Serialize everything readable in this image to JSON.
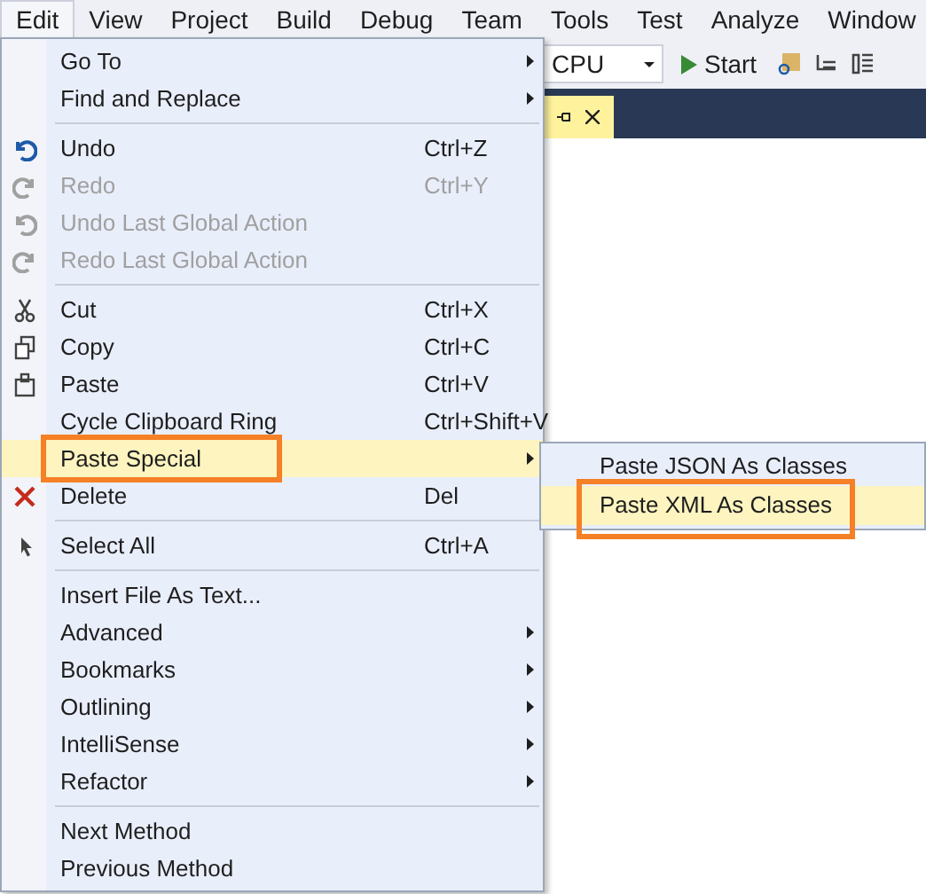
{
  "menu_bar": [
    {
      "label": "Edit",
      "selected": true
    },
    {
      "label": "View",
      "selected": false
    },
    {
      "label": "Project",
      "selected": false
    },
    {
      "label": "Build",
      "selected": false
    },
    {
      "label": "Debug",
      "selected": false
    },
    {
      "label": "Team",
      "selected": false
    },
    {
      "label": "Tools",
      "selected": false
    },
    {
      "label": "Test",
      "selected": false
    },
    {
      "label": "Analyze",
      "selected": false
    },
    {
      "label": "Window",
      "selected": false
    }
  ],
  "toolbar": {
    "platform": "CPU",
    "start": "Start"
  },
  "edit_menu": [
    {
      "kind": "item",
      "label": "Go To",
      "submenu": true,
      "disabled": false,
      "selected": false
    },
    {
      "kind": "item",
      "label": "Find and Replace",
      "submenu": true,
      "disabled": false,
      "selected": false
    },
    {
      "kind": "separator"
    },
    {
      "kind": "item",
      "label": "Undo",
      "shortcut": "Ctrl+Z",
      "disabled": false,
      "selected": false
    },
    {
      "kind": "item",
      "label": "Redo",
      "shortcut": "Ctrl+Y",
      "disabled": true,
      "selected": false
    },
    {
      "kind": "item",
      "label": "Undo Last Global Action",
      "disabled": true,
      "selected": false
    },
    {
      "kind": "item",
      "label": "Redo Last Global Action",
      "disabled": true,
      "selected": false
    },
    {
      "kind": "separator"
    },
    {
      "kind": "item",
      "label": "Cut",
      "shortcut": "Ctrl+X",
      "disabled": false,
      "selected": false
    },
    {
      "kind": "item",
      "label": "Copy",
      "shortcut": "Ctrl+C",
      "disabled": false,
      "selected": false
    },
    {
      "kind": "item",
      "label": "Paste",
      "shortcut": "Ctrl+V",
      "disabled": false,
      "selected": false
    },
    {
      "kind": "item",
      "label": "Cycle Clipboard Ring",
      "shortcut": "Ctrl+Shift+V",
      "disabled": false,
      "selected": false
    },
    {
      "kind": "item",
      "label": "Paste Special",
      "submenu": true,
      "disabled": false,
      "selected": true,
      "callout": true
    },
    {
      "kind": "item",
      "label": "Delete",
      "shortcut": "Del",
      "disabled": false,
      "selected": false
    },
    {
      "kind": "separator"
    },
    {
      "kind": "item",
      "label": "Select All",
      "shortcut": "Ctrl+A",
      "disabled": false,
      "selected": false
    },
    {
      "kind": "separator"
    },
    {
      "kind": "item",
      "label": "Insert File As Text...",
      "disabled": false,
      "selected": false
    },
    {
      "kind": "item",
      "label": "Advanced",
      "submenu": true,
      "disabled": false,
      "selected": false
    },
    {
      "kind": "item",
      "label": "Bookmarks",
      "submenu": true,
      "disabled": false,
      "selected": false
    },
    {
      "kind": "item",
      "label": "Outlining",
      "submenu": true,
      "disabled": false,
      "selected": false
    },
    {
      "kind": "item",
      "label": "IntelliSense",
      "submenu": true,
      "disabled": false,
      "selected": false
    },
    {
      "kind": "item",
      "label": "Refactor",
      "submenu": true,
      "disabled": false,
      "selected": false
    },
    {
      "kind": "separator"
    },
    {
      "kind": "item",
      "label": "Next Method",
      "disabled": false,
      "selected": false
    },
    {
      "kind": "item",
      "label": "Previous Method",
      "disabled": false,
      "selected": false
    }
  ],
  "paste_special_menu": [
    {
      "label": "Paste JSON As Classes",
      "selected": false,
      "callout": false
    },
    {
      "label": "Paste XML As Classes",
      "selected": true,
      "callout": true
    }
  ]
}
